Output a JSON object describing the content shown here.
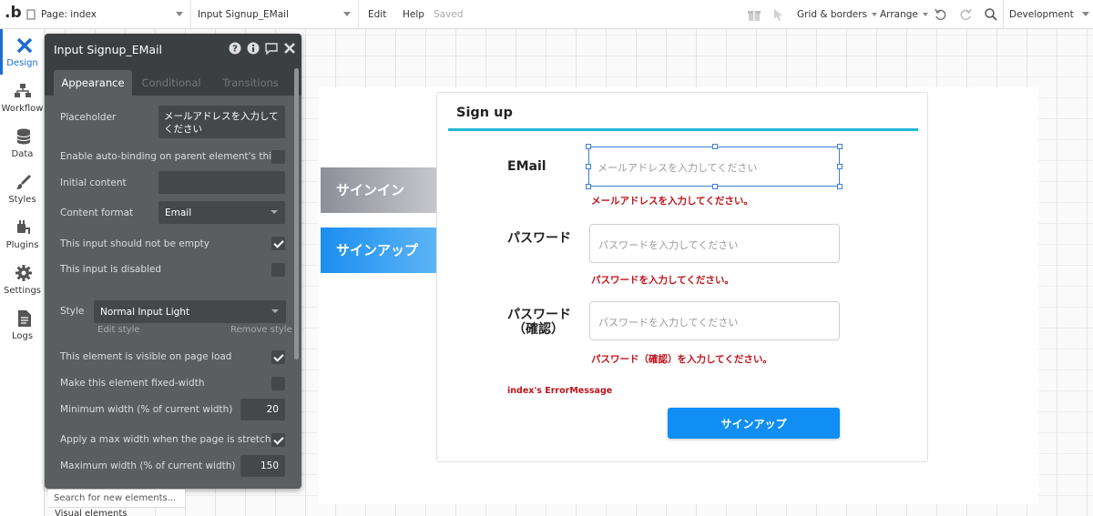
{
  "topbar": {
    "logo": ".b",
    "page_select": "Page: index",
    "element_select": "Input Signup_EMail",
    "edit": "Edit",
    "help": "Help",
    "saved": "Saved",
    "grid": "Grid & borders",
    "arrange": "Arrange",
    "environment": "Development"
  },
  "nav": [
    {
      "label": "Design",
      "icon": "design-icon"
    },
    {
      "label": "Workflow",
      "icon": "workflow-icon"
    },
    {
      "label": "Data",
      "icon": "database-icon"
    },
    {
      "label": "Styles",
      "icon": "brush-icon"
    },
    {
      "label": "Plugins",
      "icon": "plug-icon"
    },
    {
      "label": "Settings",
      "icon": "gear-icon"
    },
    {
      "label": "Logs",
      "icon": "document-icon"
    }
  ],
  "panel": {
    "title": "Input Signup_EMail",
    "tabs": [
      "Appearance",
      "Conditional",
      "Transitions"
    ],
    "placeholder_label": "Placeholder",
    "placeholder_value": "メールアドレスを入力してください",
    "autobinding_label": "Enable auto-binding on parent element's thing",
    "initial_content_label": "Initial content",
    "content_format_label": "Content format",
    "content_format_value": "Email",
    "not_empty_label": "This input should not be empty",
    "disabled_label": "This input is disabled",
    "style_label": "Style",
    "style_value": "Normal Input Light",
    "edit_style": "Edit style",
    "remove_style": "Remove style",
    "visible_label": "This element is visible on page load",
    "fixed_width_label": "Make this element fixed-width",
    "min_width_label": "Minimum width (% of current width)",
    "min_width_value": "20",
    "max_width_apply_label": "Apply a max width when the page is stretched",
    "max_width_label": "Maximum width (% of current width)",
    "max_width_value": "150"
  },
  "search_new": "Search for new elements...",
  "visual_elements": "Visual elements",
  "page": {
    "signin": "サインイン",
    "signup_side": "サインアップ",
    "card_title": "Sign up",
    "email_label": "EMail",
    "email_placeholder": "メールアドレスを入力してください",
    "email_error": "メールアドレスを入力してください。",
    "password_label": "パスワード",
    "password_placeholder": "パスワードを入力してください",
    "password_error": "パスワードを入力してください。",
    "confirm_label_1": "パスワード",
    "confirm_label_2": "（確認）",
    "confirm_placeholder": "パスワードを入力してください",
    "confirm_error": "パスワード（確認）を入力してください。",
    "error_message": "index's ErrorMessage",
    "submit": "サインアップ"
  },
  "colors": {
    "accent_blue": "#108ef3",
    "line_cyan": "#22b7d8",
    "error_red": "#c0121b",
    "panel_bg": "#5b5e61"
  }
}
